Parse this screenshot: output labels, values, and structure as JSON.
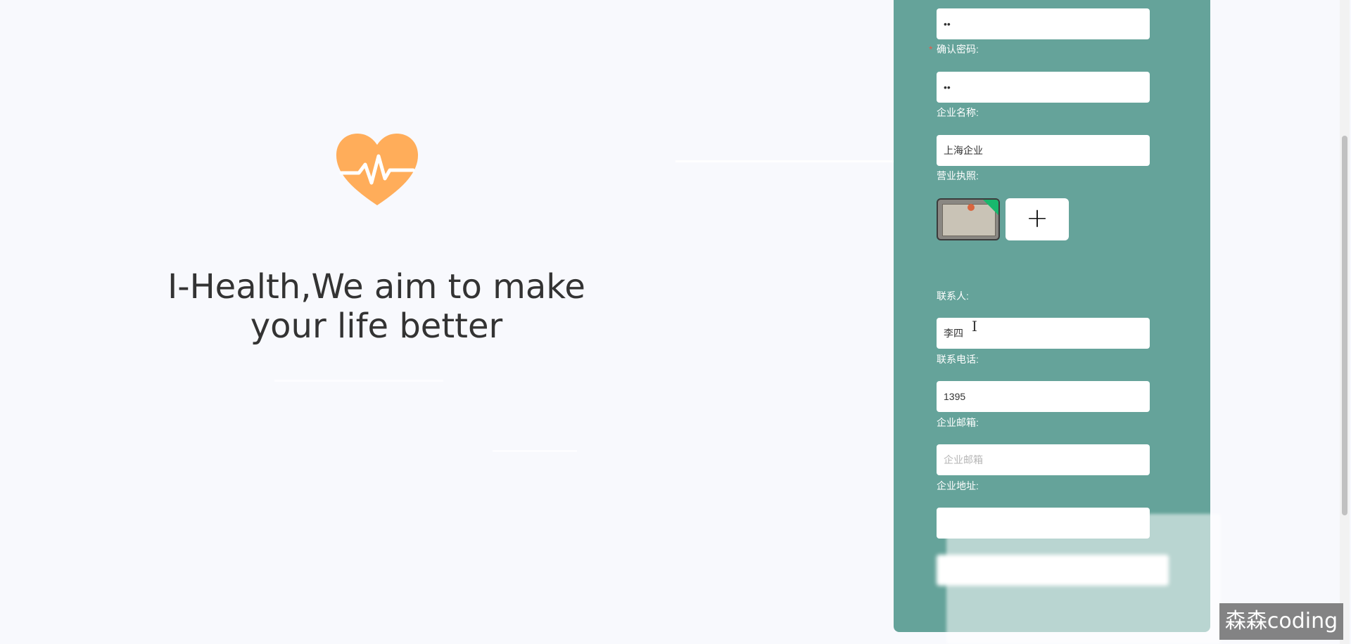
{
  "hero": {
    "logo_icon": "heart-pulse-icon",
    "tagline_line1": "I-Health,We aim to make",
    "tagline_line2": "your life better"
  },
  "colors": {
    "panel": "#65a39a",
    "logo": "#ffad5a",
    "required": "#e55a4a",
    "badge": "#18b86d"
  },
  "form": {
    "password_value": "12",
    "confirm_password": {
      "label": "确认密码:",
      "value": "12"
    },
    "company_name": {
      "label": "企业名称:",
      "value": "上海企业"
    },
    "business_license": {
      "label": "营业执照:",
      "add_icon": "plus-icon",
      "add_glyph": "+"
    },
    "contact_person": {
      "label": "联系人:",
      "value": "李四"
    },
    "contact_phone": {
      "label": "联系电话:",
      "value": "1395"
    },
    "company_email": {
      "label": "企业邮箱:",
      "placeholder": "企业邮箱"
    },
    "company_address": {
      "label": "企业地址:"
    }
  },
  "watermark": "森森coding"
}
